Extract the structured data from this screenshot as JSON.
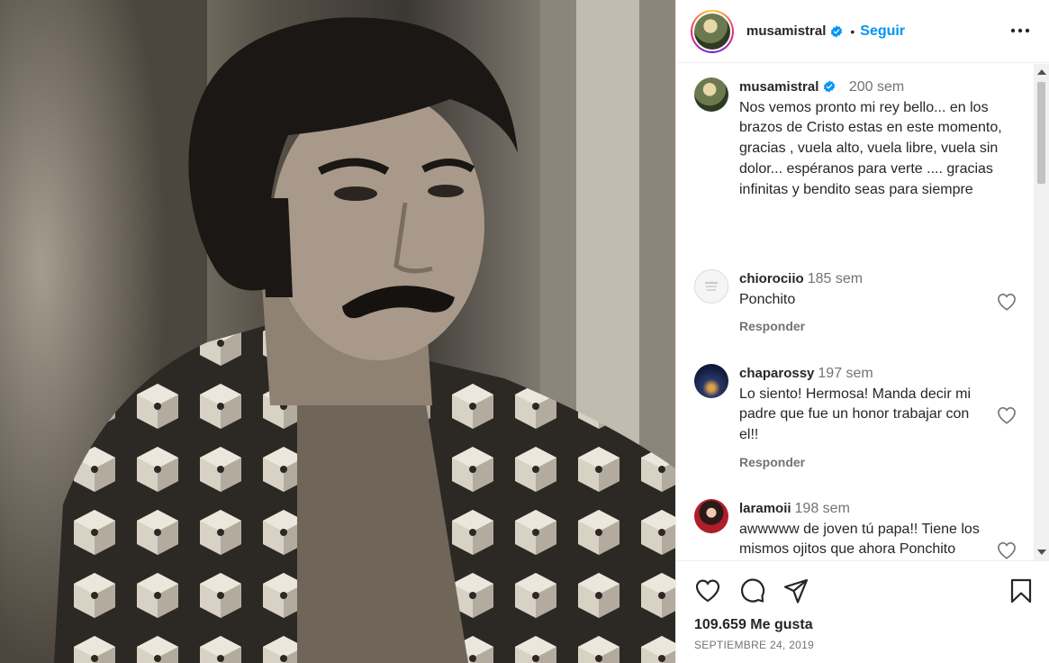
{
  "post": {
    "username": "musamistral",
    "follow_label": "Seguir",
    "separator": "•",
    "caption": {
      "username": "musamistral",
      "time": "200 sem",
      "text": "Nos vemos pronto mi rey bello... en los brazos de Cristo estas en este momento, gracias , vuela alto, vuela libre, vuela sin dolor... espéranos para verte .... gracias infinitas y bendito seas para siempre"
    },
    "comments": [
      {
        "username": "chiorociio",
        "time": "185 sem",
        "text": "Ponchito",
        "reply": "Responder"
      },
      {
        "username": "chaparossy",
        "time": "197 sem",
        "text": "Lo siento! Hermosa! Manda decir mi padre que fue un honor trabajar con el!!",
        "reply": "Responder"
      },
      {
        "username": "laramoii",
        "time": "198 sem",
        "text": "awwwww de joven tú papa!! Tiene los mismos ojitos que ahora Ponchito"
      }
    ],
    "likes": "109.659 Me gusta",
    "date": "SEPTIEMBRE 24, 2019"
  },
  "colors": {
    "accent": "#0095f6",
    "verified": "#0095f6",
    "secondary_text": "#737373"
  },
  "icons": [
    "verified-badge-icon",
    "more-options-icon",
    "heart-icon",
    "comment-icon",
    "share-icon",
    "bookmark-icon"
  ]
}
